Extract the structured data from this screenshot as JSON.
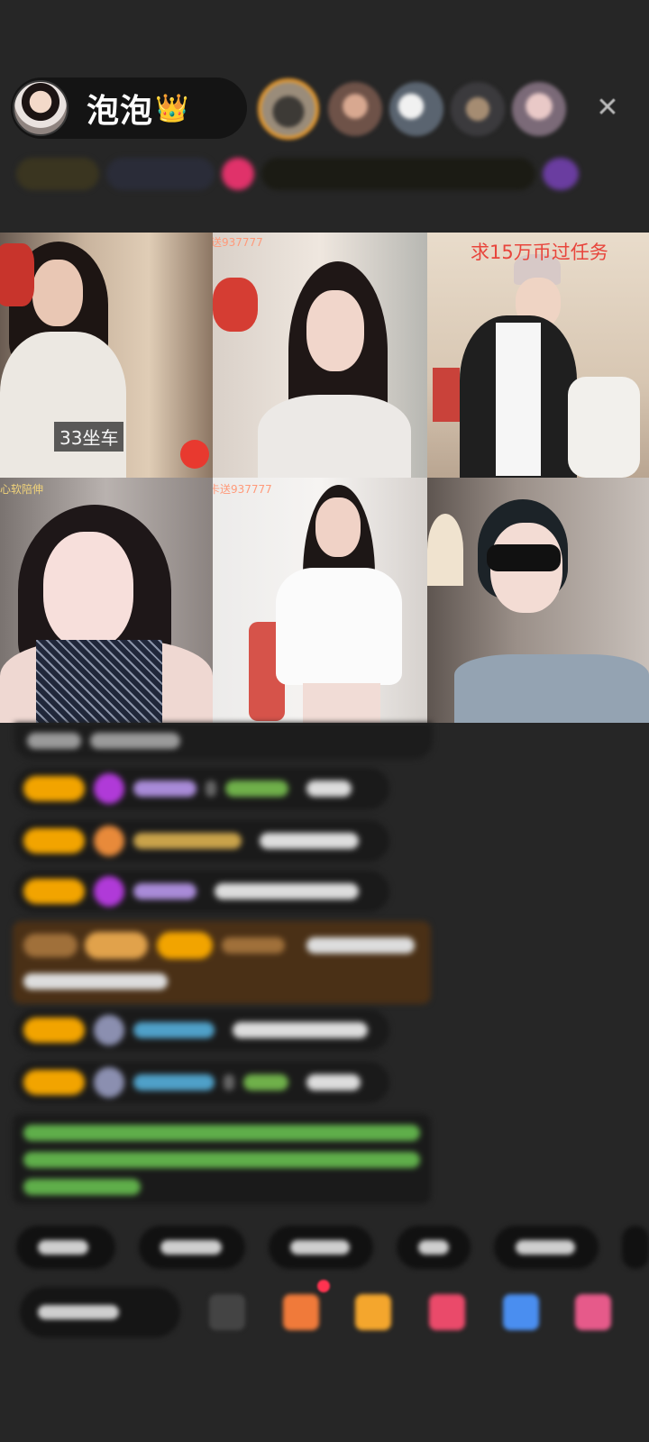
{
  "host": {
    "name": "泡泡",
    "crown": "👑"
  },
  "header": {
    "close_label": "✕"
  },
  "tiles": [
    {
      "caption": "33坐车"
    },
    {
      "caption": "卡送937777"
    },
    {
      "caption": "求15万币过任务"
    },
    {
      "caption": "心软陪伸"
    },
    {
      "caption": "卡送937777"
    },
    {
      "caption": ""
    }
  ],
  "colors": {
    "background": "#262626",
    "level_badge": "#f2a400",
    "gift_border": "#e89a2d",
    "caption_red": "#e8453c"
  },
  "icons": [
    "crown-icon",
    "close-icon",
    "gift-icon",
    "chat-icon",
    "share-icon"
  ]
}
